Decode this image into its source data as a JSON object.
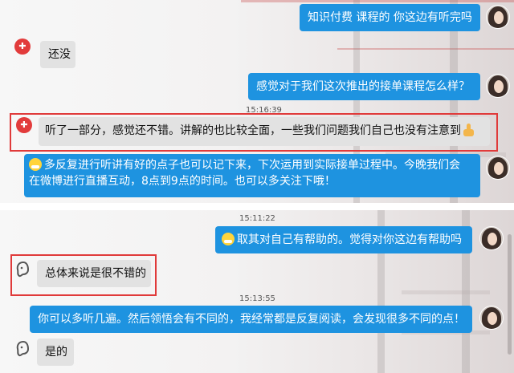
{
  "panel1": {
    "messages": [
      {
        "text": "知识付费 课程的 你这边有听完吗",
        "side": "outgoing"
      },
      {
        "text": "还没",
        "side": "incoming"
      },
      {
        "text": "感觉对于我们这次推出的接单课程怎么样？",
        "side": "outgoing"
      },
      {
        "text": "听了一部分，感觉还不错。讲解的也比较全面，一些我们问题我们自己也没有注意到",
        "side": "incoming",
        "highlighted": true
      },
      {
        "line1": "多反复进行听讲有好的点子也可以记下来，下次运用到实际接单过程中。今晚我们会",
        "line2": "在微博进行直播互动，8点到9点的时间。也可以多关注下哦！",
        "side": "outgoing",
        "leading_emoji": "grin-emoji"
      }
    ],
    "timestamp": "15:16:39"
  },
  "panel2": {
    "messages": [
      {
        "text": "取其对自己有帮助的。觉得对你这边有帮助吗",
        "side": "outgoing",
        "leading_emoji": "grin-emoji"
      },
      {
        "text": "总体来说是很不错的",
        "side": "incoming",
        "highlighted": true
      },
      {
        "text": "你可以多听几遍。然后领悟会有不同的，我经常都是反复阅读，会发现很多不同的点！",
        "side": "outgoing"
      },
      {
        "text": "是的",
        "side": "incoming"
      }
    ],
    "timestamps": [
      "15:11:22",
      "15:13:55"
    ]
  },
  "colors": {
    "outgoing_bubble": "#1e93e0",
    "incoming_bubble": "#e2e2e2",
    "highlight_border": "#e03a3a"
  }
}
